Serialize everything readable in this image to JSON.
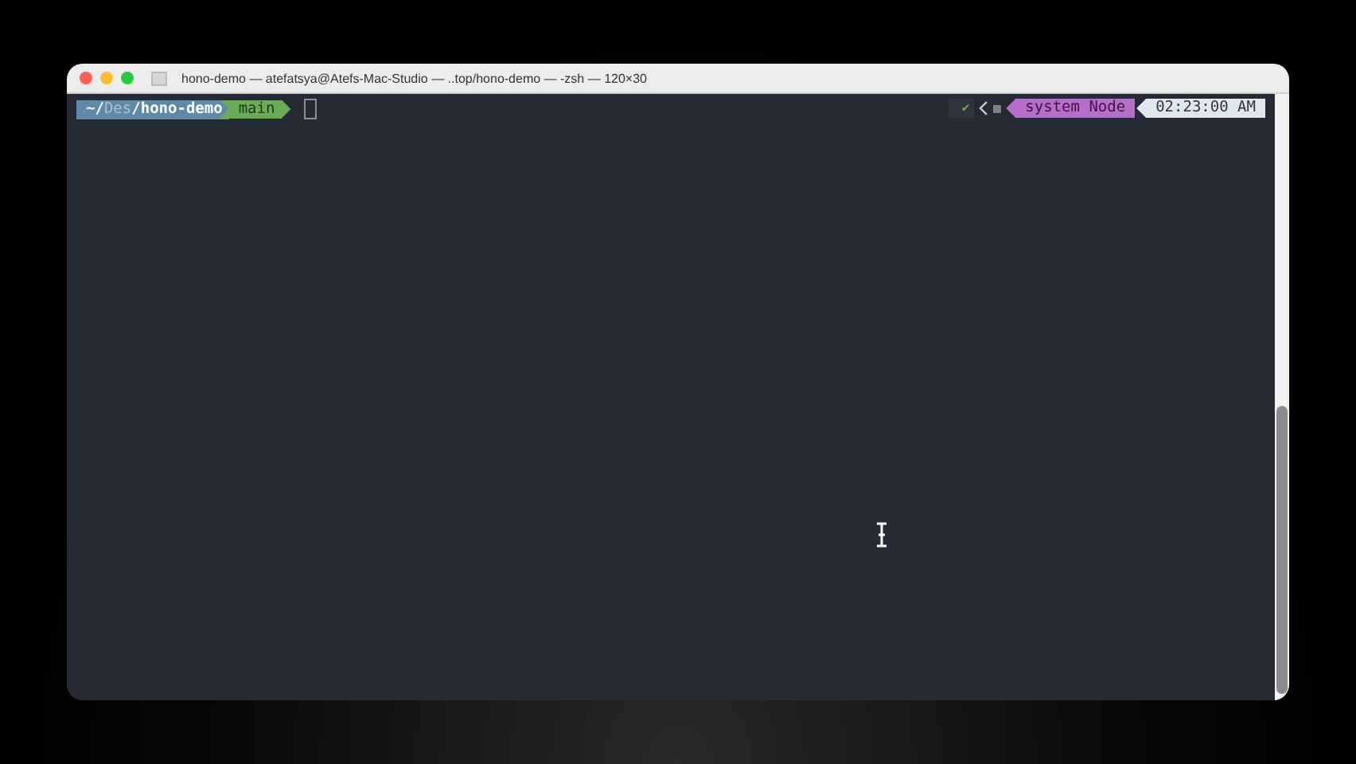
{
  "window": {
    "title": "hono-demo — atefatsya@Atefs-Mac-Studio — ..top/hono-demo — -zsh — 120×30"
  },
  "prompt": {
    "path": [
      {
        "text": "~/",
        "dim": false
      },
      {
        "text": "Des",
        "dim": true
      },
      {
        "text": "/hono-demo",
        "dim": false
      }
    ],
    "branch": "main"
  },
  "right_prompt": {
    "status": "✔",
    "node": "system Node",
    "time": "02:23:00 AM"
  }
}
